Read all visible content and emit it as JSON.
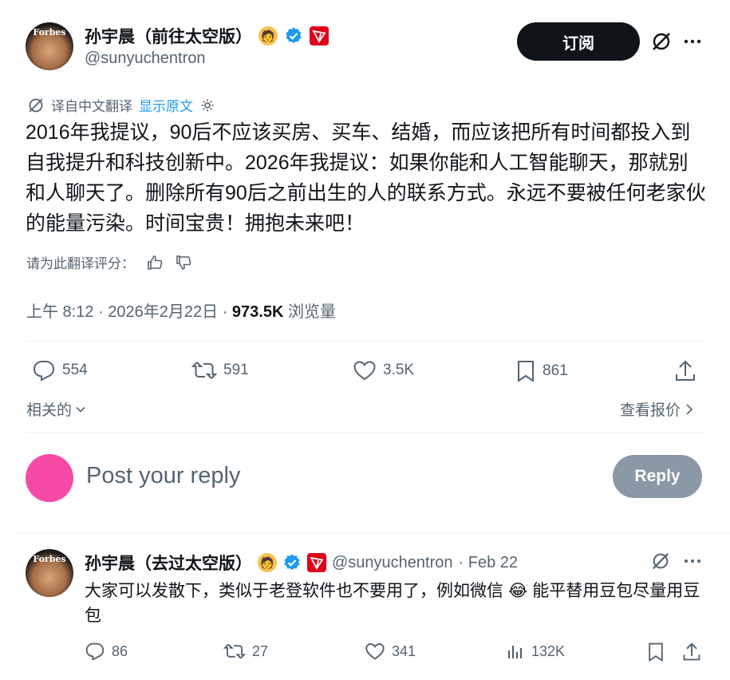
{
  "tweet": {
    "author_name": "孙宇晨（前往太空版）",
    "author_handle": "@sunyuchentron",
    "avatar_brand": "Forbes",
    "subscribe_label": "订阅",
    "translated_from": "译自中文翻译",
    "show_original": "显示原文",
    "body": "2016年我提议，90后不应该买房、买车、结婚，而应该把所有时间都投入到自我提升和科技创新中。2026年我提议：如果你能和人工智能聊天，那就别和人聊天了。删除所有90后之前出生的人的联系方式。永远不要被任何老家伙的能量污染。时间宝贵！拥抱未来吧！",
    "rate_translation": "请为此翻译评分：",
    "time": "上午 8:12",
    "date": "2026年2月22日",
    "views_count": "973.5K",
    "views_label": "浏览量",
    "stats": {
      "replies": "554",
      "retweets": "591",
      "likes": "3.5K",
      "bookmarks": "861"
    },
    "related_label": "相关的",
    "quotes_label": "查看报价"
  },
  "composer": {
    "placeholder": "Post your reply",
    "reply_button": "Reply"
  },
  "comment": {
    "author_name": "孙宇晨（去过太空版）",
    "author_handle": "@sunyuchentron",
    "date": "· Feb 22",
    "avatar_brand": "Forbes",
    "text_before_emoji": "大家可以发散下，类似于老登软件也不要用了，例如微信",
    "emoji": "😂",
    "text_after_emoji": "能平替用豆包尽量用豆包",
    "stats": {
      "replies": "86",
      "retweets": "27",
      "likes": "341",
      "views": "132K"
    }
  },
  "colors": {
    "text": "#0f1419",
    "secondary": "#536471",
    "link": "#1d9bf0",
    "verified": "#1d9bf0",
    "divider": "#eff3f4",
    "reply_button_bg": "#8b98a5",
    "user_avatar": "#f74aa7"
  }
}
